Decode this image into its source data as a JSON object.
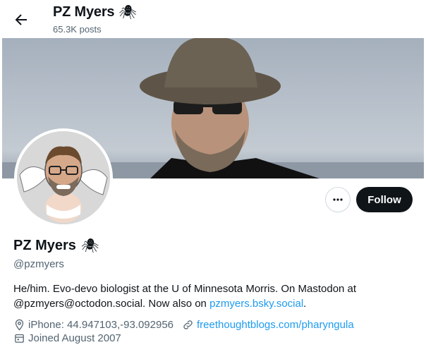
{
  "header": {
    "title": "PZ Myers",
    "title_emoji": "🕷",
    "posts": "65.3K posts"
  },
  "actions": {
    "more_label": "···",
    "follow_label": "Follow"
  },
  "profile": {
    "name": "PZ Myers",
    "name_emoji": "🕷",
    "handle": "@pzmyers",
    "bio_text": "He/him. Evo-devo biologist at the U of Minnesota Morris. On Mastodon at @pzmyers@octodon.social. Now also on ",
    "bio_link": "pzmyers.bsky.social",
    "bio_end": "."
  },
  "meta": {
    "location": "iPhone: 44.947103,-93.092956",
    "website": "freethoughtblogs.com/pharyngula",
    "joined": "Joined August 2007"
  },
  "colors": {
    "accent": "#1d9bf0",
    "text": "#0f1419",
    "muted": "#536471"
  },
  "icons": [
    "back-arrow-icon",
    "spider-icon",
    "more-icon",
    "location-icon",
    "link-icon",
    "calendar-icon"
  ]
}
